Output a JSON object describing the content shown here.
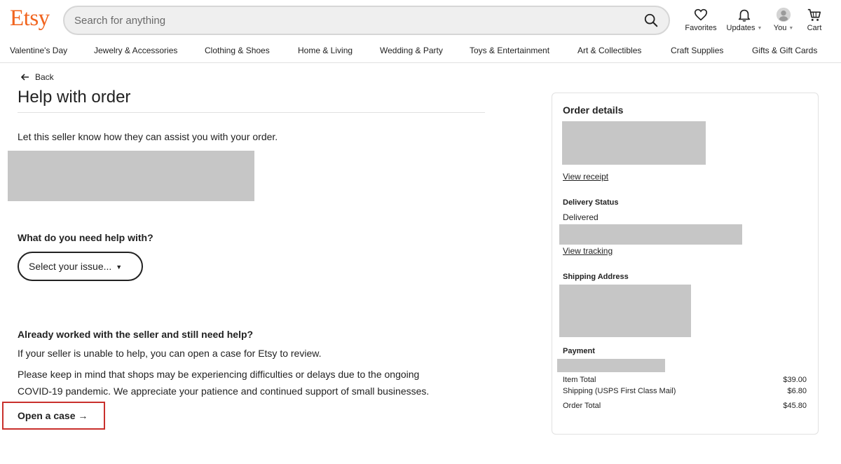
{
  "header": {
    "logo": "Etsy",
    "search_placeholder": "Search for anything",
    "favorites": "Favorites",
    "updates": "Updates",
    "you": "You",
    "cart": "Cart"
  },
  "categories": [
    "Valentine's Day",
    "Jewelry & Accessories",
    "Clothing & Shoes",
    "Home & Living",
    "Wedding & Party",
    "Toys & Entertainment",
    "Art & Collectibles",
    "Craft Supplies",
    "Gifts & Gift Cards"
  ],
  "main": {
    "back": "Back",
    "title": "Help with order",
    "intro": "Let this seller know how they can assist you with your order.",
    "question": "What do you need help with?",
    "select_label": "Select your issue...",
    "worked_title": "Already worked with the seller and still need help?",
    "worked_text": "If your seller is unable to help, you can open a case for Etsy to review.",
    "covid_line1": "Please keep in mind that shops may be experiencing difficulties or delays due to the ongoing",
    "covid_line2": "COVID-19 pandemic. We appreciate your patience and continued support of small businesses.",
    "open_case": "Open a case →"
  },
  "order": {
    "title": "Order details",
    "view_receipt": "View receipt",
    "delivery_title": "Delivery Status",
    "delivery_status": "Delivered",
    "view_tracking": "View tracking",
    "shipping_title": "Shipping Address",
    "payment_title": "Payment",
    "item_total_label": "Item Total",
    "item_total": "$39.00",
    "shipping_label": "Shipping (USPS First Class Mail)",
    "shipping_cost": "$6.80",
    "order_total_label": "Order Total",
    "order_total": "$45.80"
  },
  "colors": {
    "brand": "#F1641E",
    "highlight": "#c9302c",
    "redaction": "#c6c6c6"
  }
}
